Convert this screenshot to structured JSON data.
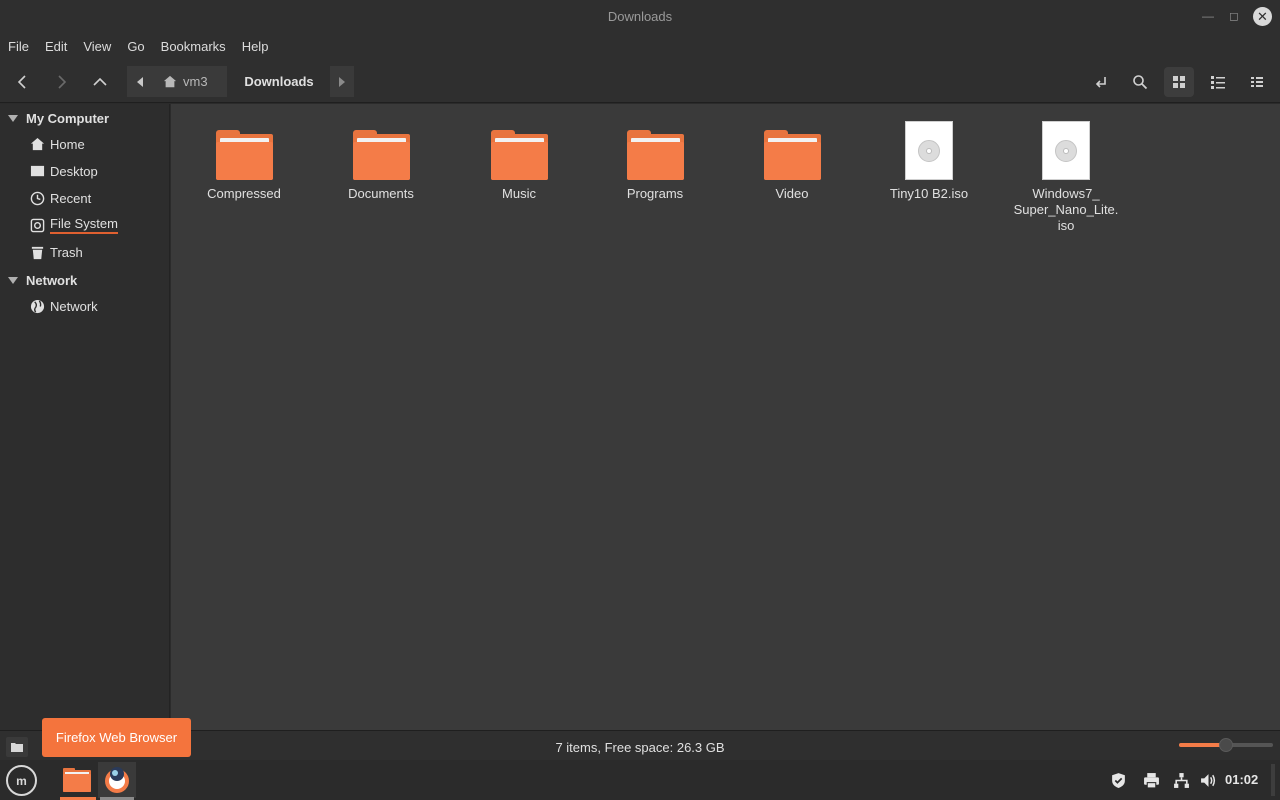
{
  "window": {
    "title": "Downloads",
    "controls": {
      "minimize": "minimize-icon",
      "maximize": "maximize-icon",
      "close": "close-icon"
    }
  },
  "menubar": [
    "File",
    "Edit",
    "View",
    "Go",
    "Bookmarks",
    "Help"
  ],
  "toolbar": {
    "breadcrumbs": [
      "vm3",
      "Downloads"
    ]
  },
  "sidebar": {
    "sections": [
      {
        "title": "My Computer",
        "items": [
          {
            "label": "Home",
            "icon": "home-icon"
          },
          {
            "label": "Desktop",
            "icon": "desktop-icon"
          },
          {
            "label": "Recent",
            "icon": "recent-icon"
          },
          {
            "label": "File System",
            "icon": "filesystem-icon"
          },
          {
            "label": "Trash",
            "icon": "trash-icon"
          }
        ]
      },
      {
        "title": "Network",
        "items": [
          {
            "label": "Network",
            "icon": "network-globe-icon"
          }
        ]
      }
    ]
  },
  "files": [
    {
      "name": "Compressed",
      "type": "folder"
    },
    {
      "name": "Documents",
      "type": "folder"
    },
    {
      "name": "Music",
      "type": "folder"
    },
    {
      "name": "Programs",
      "type": "folder"
    },
    {
      "name": "Video",
      "type": "folder"
    },
    {
      "name": "Tiny10 B2.iso",
      "type": "iso"
    },
    {
      "name": "Windows7_\nSuper_Nano_Lite.\niso",
      "type": "iso"
    }
  ],
  "status": {
    "text": "7 items, Free space: 26.3 GB",
    "zoom_level": 0.5
  },
  "tooltip": "Firefox Web Browser",
  "taskbar": {
    "clock": "01:02"
  },
  "colors": {
    "accent": "#f47c48",
    "window_bg": "#2f2f2f",
    "content_bg": "#3a3a3a"
  }
}
